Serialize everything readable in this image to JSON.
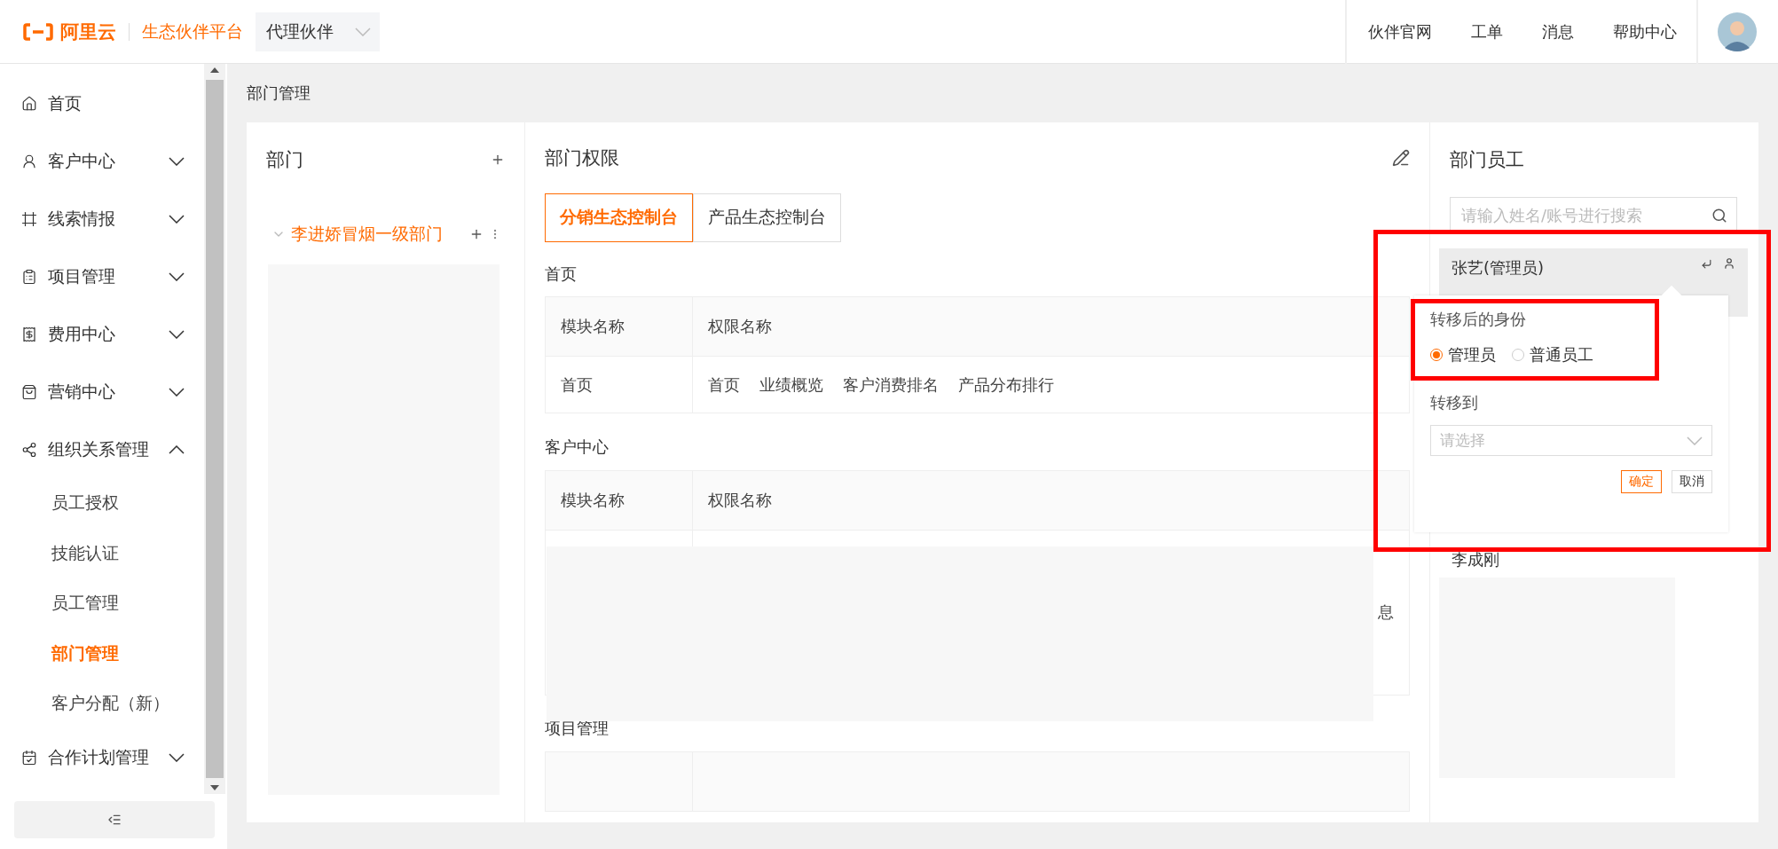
{
  "header": {
    "brand": "阿里云",
    "product": "生态伙伴平台",
    "role_select": {
      "value": "代理伙伴"
    },
    "nav_links": [
      "伙伴官网",
      "工单",
      "消息",
      "帮助中心"
    ]
  },
  "sidebar": {
    "items": [
      {
        "label": "首页",
        "kind": "link"
      },
      {
        "label": "客户中心",
        "kind": "group",
        "expanded": false
      },
      {
        "label": "线索情报",
        "kind": "group",
        "expanded": false
      },
      {
        "label": "项目管理",
        "kind": "group",
        "expanded": false
      },
      {
        "label": "费用中心",
        "kind": "group",
        "expanded": false
      },
      {
        "label": "营销中心",
        "kind": "group",
        "expanded": false
      },
      {
        "label": "组织关系管理",
        "kind": "group",
        "expanded": true,
        "children": [
          {
            "label": "员工授权",
            "selected": false
          },
          {
            "label": "技能认证",
            "selected": false
          },
          {
            "label": "员工管理",
            "selected": false
          },
          {
            "label": "部门管理",
            "selected": true
          },
          {
            "label": "客户分配（新）",
            "selected": false
          }
        ]
      },
      {
        "label": "合作计划管理",
        "kind": "group",
        "expanded": false
      }
    ]
  },
  "breadcrumb": "部门管理",
  "departments": {
    "title": "部门",
    "tree": [
      {
        "label": "李进娇冒烟一级部门",
        "selected": true,
        "expanded": true
      }
    ]
  },
  "permissions": {
    "title": "部门权限",
    "tabs": [
      {
        "label": "分销生态控制台",
        "selected": true
      },
      {
        "label": "产品生态控制台",
        "selected": false
      }
    ],
    "sections": [
      {
        "title": "首页",
        "columns": [
          "模块名称",
          "权限名称"
        ],
        "rows": [
          {
            "module": "首页",
            "permissions": [
              "首页",
              "业绩概览",
              "客户消费排名",
              "产品分布排行"
            ]
          }
        ]
      },
      {
        "title": "客户中心",
        "columns": [
          "模块名称",
          "权限名称"
        ],
        "rows": [
          {
            "permissions": [
              "息"
            ]
          }
        ]
      },
      {
        "title": "项目管理"
      }
    ]
  },
  "employees": {
    "title": "部门员工",
    "search": {
      "placeholder": "请输入姓名/账号进行搜索"
    },
    "list": [
      {
        "name": "张艺(管理员)",
        "selected": true
      },
      {
        "name": "李成刚",
        "selected": false
      }
    ]
  },
  "transfer_popover": {
    "highlighted": true,
    "identity": {
      "label": "转移后的身份",
      "highlighted": true,
      "options": [
        {
          "label": "管理员",
          "selected": true
        },
        {
          "label": "普通员工",
          "selected": false
        }
      ]
    },
    "target": {
      "label": "转移到",
      "placeholder": "请选择"
    },
    "buttons": [
      {
        "label": "确定",
        "kind": "primary"
      },
      {
        "label": "取消",
        "kind": "default"
      }
    ]
  }
}
